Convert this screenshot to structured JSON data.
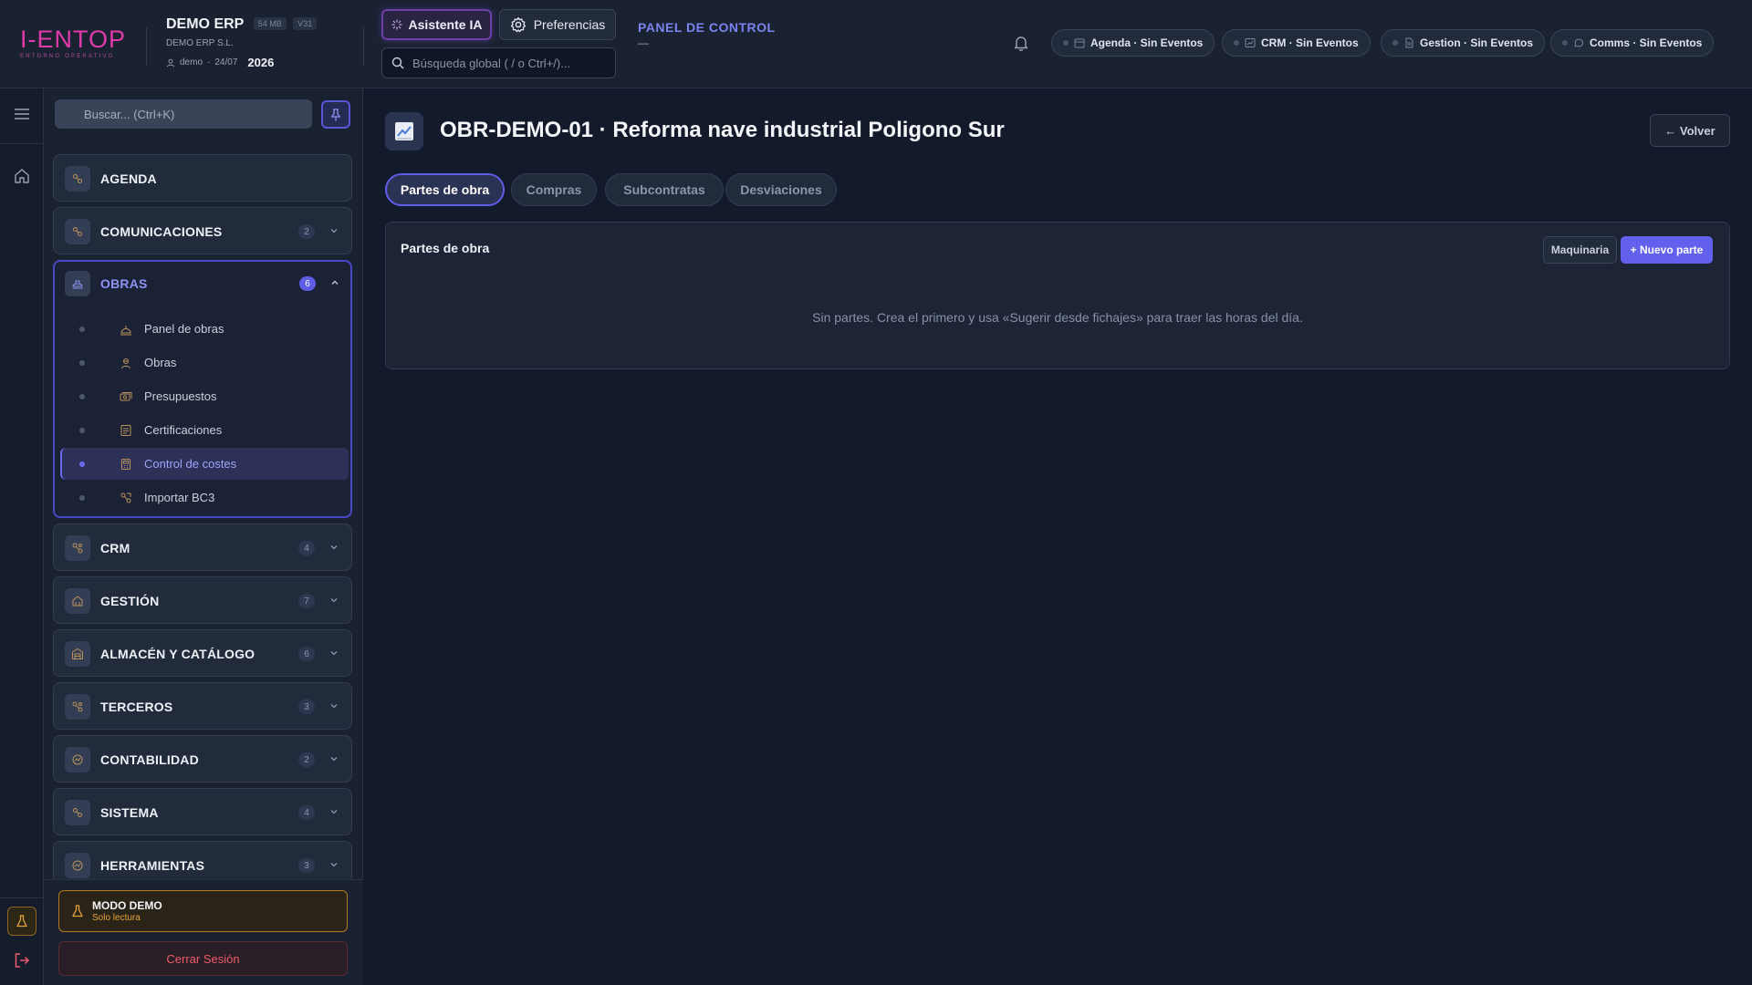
{
  "header": {
    "logo_text": "I-ENTOP",
    "logo_subtitle": "ENTORNO OPERATIVO",
    "company_name": "DEMO ERP",
    "size_chip": "54 MB",
    "version_chip": "V31",
    "company_legal": "DEMO ERP S.L.",
    "user": "demo",
    "date": "24/07",
    "year": "2026",
    "ai_button": "Asistente IA",
    "prefs_button": "Preferencias",
    "global_search_placeholder": "Búsqueda global ( / o Ctrl+/)...",
    "panel_title": "PANEL DE CONTROL",
    "panel_sub": "—",
    "status_pills": [
      {
        "label": "Agenda · Sin Eventos",
        "icon": "calendar-icon"
      },
      {
        "label": "CRM · Sin Eventos",
        "icon": "chart-icon"
      },
      {
        "label": "Gestion · Sin Eventos",
        "icon": "document-icon"
      },
      {
        "label": "Comms · Sin Eventos",
        "icon": "chat-icon"
      }
    ]
  },
  "sidebar": {
    "search_placeholder": "Buscar... (Ctrl+K)",
    "sections": [
      {
        "label": "AGENDA",
        "badge": ""
      },
      {
        "label": "COMUNICACIONES",
        "badge": "2"
      },
      {
        "label": "OBRAS",
        "badge": "6"
      },
      {
        "label": "CRM",
        "badge": "4"
      },
      {
        "label": "GESTIÓN",
        "badge": "7"
      },
      {
        "label": "ALMACÉN Y CATÁLOGO",
        "badge": "6"
      },
      {
        "label": "TERCEROS",
        "badge": "3"
      },
      {
        "label": "CONTABILIDAD",
        "badge": "2"
      },
      {
        "label": "SISTEMA",
        "badge": "4"
      },
      {
        "label": "HERRAMIENTAS",
        "badge": "3"
      }
    ],
    "obras_items": [
      {
        "label": "Panel de obras"
      },
      {
        "label": "Obras"
      },
      {
        "label": "Presupuestos"
      },
      {
        "label": "Certificaciones"
      },
      {
        "label": "Control de costes"
      },
      {
        "label": "Importar BC3"
      }
    ],
    "active_item": "Control de costes",
    "demo_title": "MODO DEMO",
    "demo_sub": "Solo lectura",
    "logout": "Cerrar Sesión"
  },
  "main": {
    "title": "OBR-DEMO-01 · Reforma nave industrial Poligono Sur",
    "back_button": "← Volver",
    "tabs": [
      {
        "label": "Partes de obra",
        "active": true
      },
      {
        "label": "Compras",
        "active": false
      },
      {
        "label": "Subcontratas",
        "active": false
      },
      {
        "label": "Desviaciones",
        "active": false
      }
    ],
    "card": {
      "title": "Partes de obra",
      "btn_maquinaria": "Maquinaria",
      "btn_nuevo": "+ Nuevo parte",
      "empty": "Sin partes. Crea el primero y usa «Sugerir desde fichajes» para traer las horas del día."
    }
  },
  "colors": {
    "accent": "#6360ee",
    "logo": "#e13aa8",
    "warning": "#e8a33a",
    "danger": "#f05a6a"
  }
}
